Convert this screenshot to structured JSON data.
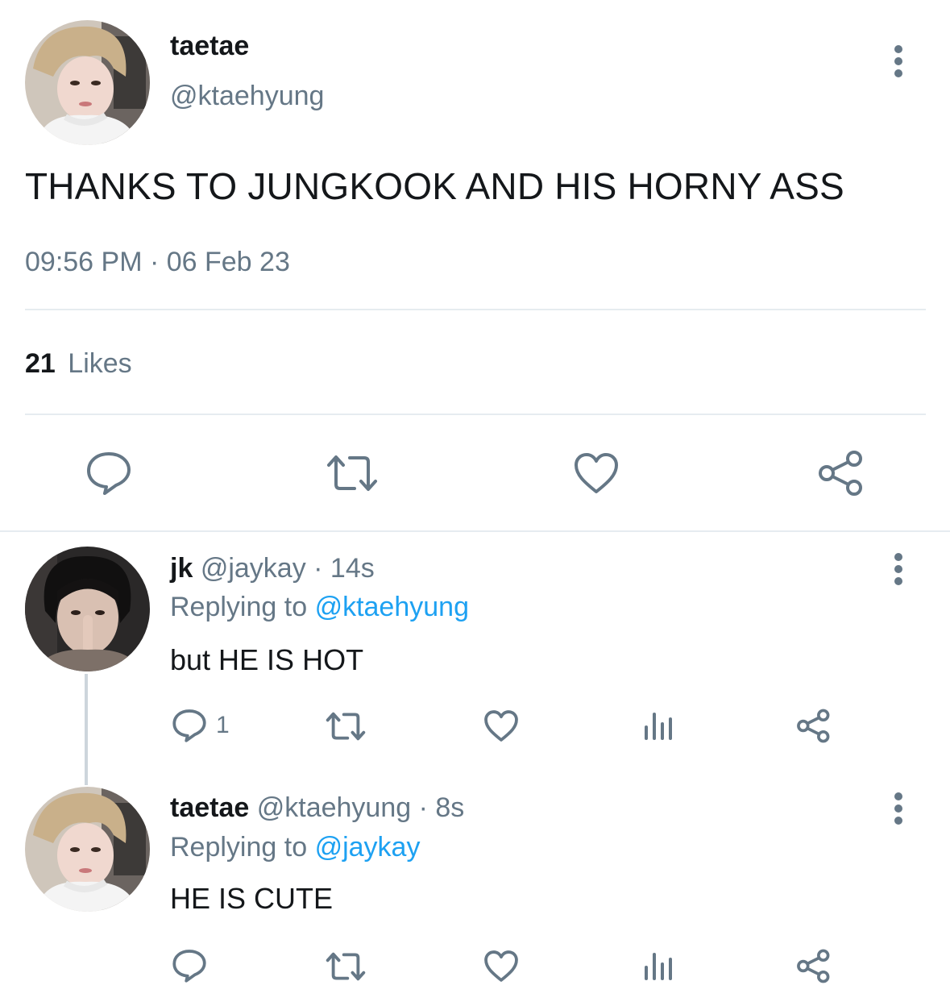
{
  "main_tweet": {
    "display_name": "taetae",
    "handle": "@ktaehyung",
    "text": "THANKS TO JUNGKOOK AND HIS HORNY ASS",
    "timestamp": "09:56 PM · 06 Feb 23",
    "likes_count": "21",
    "likes_label": "Likes"
  },
  "replies": [
    {
      "display_name": "jk",
      "handle": "@jaykay",
      "time": "· 14s",
      "replying_prefix": "Replying to",
      "replying_to": "@ktaehyung",
      "text": "but HE IS HOT",
      "reply_count": "1"
    },
    {
      "display_name": "taetae",
      "handle": "@ktaehyung",
      "time": "· 8s",
      "replying_prefix": "Replying to",
      "replying_to": "@jaykay",
      "text": "HE IS CUTE",
      "reply_count": ""
    }
  ],
  "colors": {
    "text": "#14171a",
    "muted": "#657786",
    "link": "#1da1f2",
    "divider": "#e6ecf0"
  },
  "icons": [
    "more-icon",
    "reply-icon",
    "retweet-icon",
    "like-icon",
    "share-icon",
    "analytics-icon"
  ]
}
